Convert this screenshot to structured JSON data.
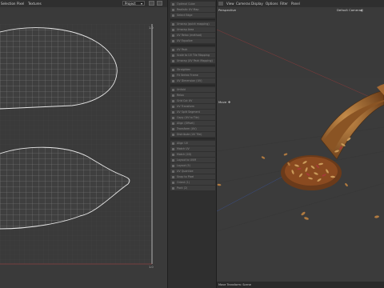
{
  "uv_editor": {
    "menu": [
      "Selection",
      "Pixel",
      "Textures"
    ],
    "project_select": "Project",
    "ticks": {
      "top_right": "1.0",
      "bottom_right": "1.0"
    }
  },
  "tool_panel": {
    "groups": [
      [
        "Optimal Cube",
        "Realistic UV Map",
        "Select Edge"
      ],
      [
        "Unwrap (quick mapping)",
        "Unwrap Area",
        "UV Relax (method)",
        "UV Equalize"
      ],
      [
        "UV Pack",
        "Scale to UV Tile Mapping",
        "Unwrap (UV Pack Mapping)"
      ],
      [
        "Straighten",
        "Fit Vertex Frame",
        "UV Dimension (UV)"
      ],
      [
        "Unfold",
        "Relax",
        "Grid Cut UV",
        "UV Transform",
        "UV Split Segment",
        "Copy (UV to Tile)",
        "Align (Offset)",
        "Transform (UV)",
        "Distribute (UV Tile)"
      ],
      [
        "Align UV",
        "Match UV",
        "Match (2D)",
        "Layout to UVM",
        "Layout (5)",
        "UV Quantize",
        "Snap to Pixel",
        "Orient (1)",
        "Pack (2)"
      ]
    ]
  },
  "viewport": {
    "menu": [
      "View",
      "Cameras",
      "Display",
      "Options",
      "Filter",
      "Panel"
    ],
    "view_label": "Perspective",
    "camera_label": "Default Camera",
    "camera_icon": "camera-circle-icon",
    "tool_label": "Move",
    "tool_icon": "move-arrows-icon",
    "status": "Move Transform: Scene"
  }
}
